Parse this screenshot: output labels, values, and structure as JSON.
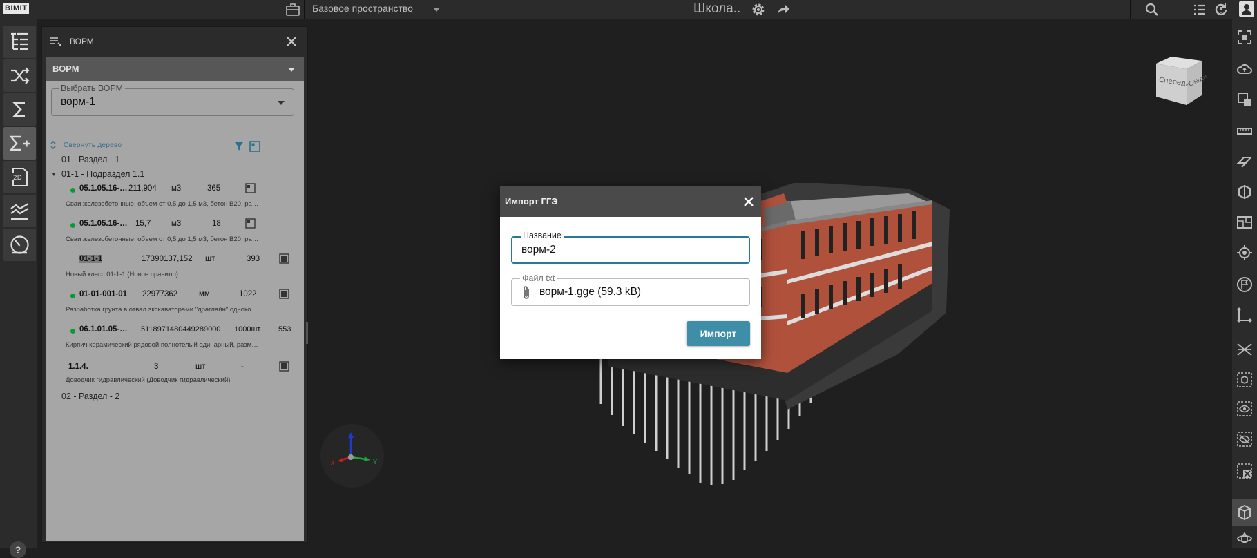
{
  "topbar": {
    "logo": "BIMIT",
    "workspace": "Базовое пространство",
    "project_name": "Школа.."
  },
  "panel": {
    "title": "ВОРМ",
    "section_title": "ВОРМ",
    "select": {
      "legend": "Выбрать ВОРМ",
      "value": "ворм-1"
    },
    "collapse_label": "Свернуть дерево",
    "tree": {
      "section1": "01 - Раздел - 1",
      "subsection1": "01-1 - Подраздел 1.1",
      "rows": [
        {
          "code": "05.1.05.16-…",
          "qty": "211,904",
          "unit": "м3",
          "count": "365",
          "desc": "Сваи железобетонные, объем от 0,5 до 1,5 м3, бетон B20, расход а…",
          "dot": true
        },
        {
          "code": "05.1.05.16-…",
          "qty": "15,7",
          "unit": "м3",
          "count": "18",
          "desc": "Сваи железобетонные, объем от 0,5 до 1,5 м3, бетон B20, расход а…",
          "dot": true
        },
        {
          "code": "01-1-1",
          "qty": "17390137,152",
          "unit": "шт",
          "count": "393",
          "desc": "Новый класс 01-1-1 (Новое правило)",
          "dot": true
        },
        {
          "code": "01-01-001-01",
          "qty": "22977362",
          "unit": "мм",
          "count": "1022",
          "desc": "Разработка грунта в отвал экскаваторами \"драглайн\" одноковшо…",
          "dot": true
        },
        {
          "code": "06.1.01.05-…",
          "qty": "5118971480449289000",
          "unit": "1000шт",
          "count": "553",
          "desc": "Кирпич керамический рядовой полнотелый одинарный, размеры…",
          "dot": true
        },
        {
          "code": "1.1.4.",
          "qty": "3",
          "unit": "шт",
          "count": "-",
          "desc": "Доводчик гидравлический (Доводчик гидравлический)",
          "dot": false
        }
      ],
      "section2": "02 - Раздел - 2"
    }
  },
  "viewcube": {
    "face1": "Спереди",
    "face2": "Сзади"
  },
  "axes": {
    "x": "X",
    "y": "Y"
  },
  "dialog": {
    "title": "Импорт ГГЭ",
    "name_legend": "Название",
    "name_value": "ворм-2",
    "file_legend": "Файл txt",
    "file_value": "ворм-1.gge (59.3 kB)",
    "import_label": "Импорт"
  },
  "help_label": "?",
  "icons": {
    "left": [
      "tree-structure-icon",
      "shuffle-icon",
      "sigma-icon",
      "sigma-plus-icon",
      "drawing-2d-icon",
      "chart-lines-icon",
      "gauge-icon"
    ],
    "right": [
      "fit-view-icon",
      "cloud-sync-icon",
      "selection-tool-icon",
      "ruler-icon",
      "section-plane-icon",
      "section-box-icon",
      "floor-plan-icon",
      "locate-icon",
      "navigation-flag-icon",
      "measure-points-icon",
      "cross-section-icon",
      "isolate-box-icon",
      "show-eye-icon",
      "hide-eye-icon",
      "clear-selection-icon",
      "cube-view-icon",
      "orbit-icon"
    ]
  },
  "colors": {
    "accent": "#3d8ea6",
    "status_green": "#0a9a32",
    "panel_bg": "#a6a6a6",
    "brick": "#b0513c"
  }
}
